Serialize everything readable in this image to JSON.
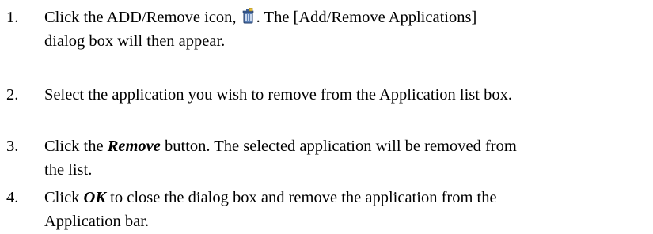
{
  "steps": [
    {
      "number": "1.",
      "line1_before": "Click the ADD/Remove icon, ",
      "icon": "add-remove-applications-icon",
      "line1_after": ". The [Add/Remove Applications]",
      "line2": "dialog box will then appear."
    },
    {
      "number": "2.",
      "text": "Select the application you wish to remove from the Application list box."
    },
    {
      "number": "3.",
      "before": "Click the ",
      "bold": "Remove",
      "after_line1": " button. The selected application will be removed from",
      "line2": "the list."
    },
    {
      "number": "4.",
      "before": "Click ",
      "bold": "OK",
      "after_line1": " to close the dialog box and remove the application from the",
      "line2": "Application bar."
    }
  ]
}
